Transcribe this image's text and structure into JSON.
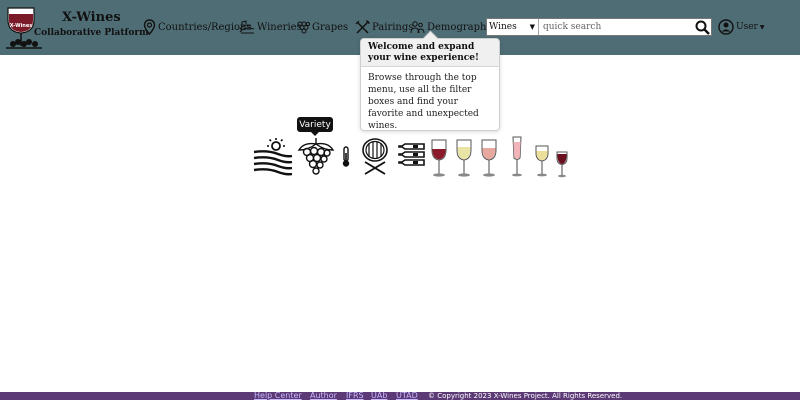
{
  "brand": {
    "title": "X-Wines",
    "subtitle": "Collaborative Platform",
    "logo_label": "X-Wines"
  },
  "nav": {
    "items": [
      {
        "label": "Countries/Regions",
        "icon": "map-pin-icon"
      },
      {
        "label": "Wineries",
        "icon": "vineyard-icon"
      },
      {
        "label": "Grapes",
        "icon": "grapes-icon"
      },
      {
        "label": "Pairings",
        "icon": "fork-knife-icon"
      },
      {
        "label": "Demographic",
        "icon": "people-icon"
      }
    ]
  },
  "search": {
    "select_value": "Wines",
    "placeholder": "quick search",
    "value": ""
  },
  "user": {
    "label": "User"
  },
  "popover": {
    "title": "Welcome and expand your wine experience!",
    "body": "Browse through the top menu, use all the filter boxes and find your favorite and unexpected wines."
  },
  "tooltip": {
    "label": "Variety"
  },
  "filter_icons": [
    {
      "name": "vineyard-sun-icon"
    },
    {
      "name": "grape-variety-icon"
    },
    {
      "name": "thermometer-icon"
    },
    {
      "name": "barrel-icon"
    },
    {
      "name": "bottles-icon"
    },
    {
      "name": "red-wine-glass-icon",
      "color": "#8b1a2a"
    },
    {
      "name": "white-wine-glass-icon",
      "color": "#e8e4a6"
    },
    {
      "name": "rose-wine-glass-icon",
      "color": "#e7a8a0"
    },
    {
      "name": "sparkling-wine-glass-icon",
      "color": "#f2b4b8"
    },
    {
      "name": "dessert-wine-glass-icon",
      "color": "#ecdf9a"
    },
    {
      "name": "fortified-wine-glass-icon",
      "color": "#6b1020"
    }
  ],
  "footer": {
    "links": [
      "Help Center",
      "Author",
      "IFRS",
      "UAb",
      "UTAD"
    ],
    "copyright": "© Copyright 2023 X-Wines Project. All Rights Reserved."
  },
  "colors": {
    "navbar": "#4f6d75",
    "footer": "#5b3a76",
    "footer_link": "#c9b8ff"
  }
}
